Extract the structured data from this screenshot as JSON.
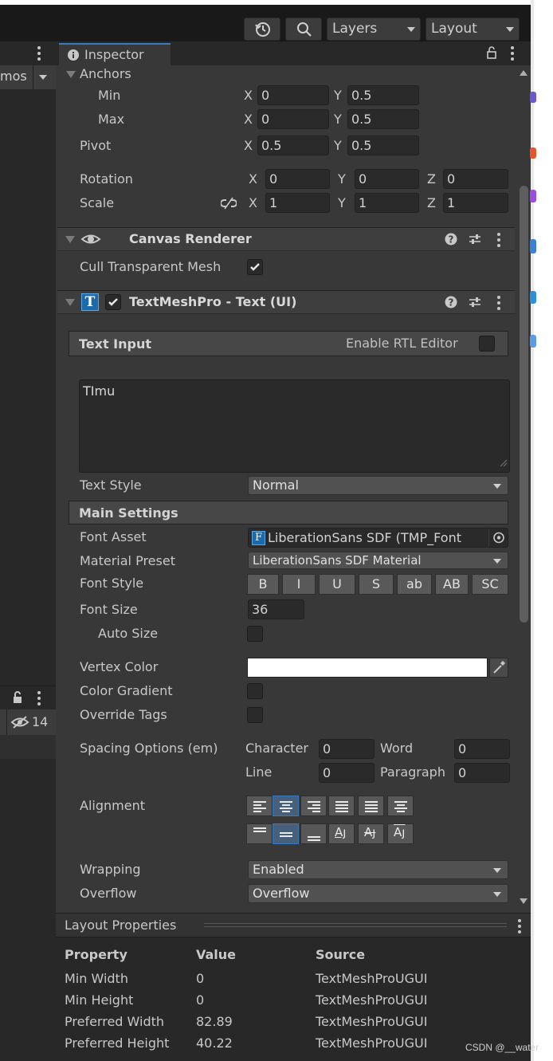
{
  "toolbar": {
    "history_icon": "history-icon",
    "search_icon": "search-icon",
    "layers_label": "Layers",
    "layout_label": "Layout"
  },
  "left_panel": {
    "tab_label": "mos",
    "hidden_count": "14"
  },
  "inspector": {
    "tab_title": "Inspector",
    "anchors": {
      "label": "Anchors",
      "min_label": "Min",
      "max_label": "Max",
      "min_x": "0",
      "min_y": "0.5",
      "max_x": "0",
      "max_y": "0.5"
    },
    "pivot": {
      "label": "Pivot",
      "x": "0.5",
      "y": "0.5"
    },
    "rotation": {
      "label": "Rotation",
      "x": "0",
      "y": "0",
      "z": "0"
    },
    "scale": {
      "label": "Scale",
      "x": "1",
      "y": "1",
      "z": "1"
    },
    "axis": {
      "x": "X",
      "y": "Y",
      "z": "Z"
    },
    "canvas_renderer": {
      "title": "Canvas Renderer",
      "cull_label": "Cull Transparent Mesh",
      "cull_checked": true
    },
    "tmp": {
      "title": "TextMeshPro - Text (UI)",
      "text_input_label": "Text Input",
      "rtl_label": "Enable RTL Editor",
      "text_value": "TImu",
      "text_style_label": "Text Style",
      "text_style_value": "Normal",
      "main_settings_label": "Main Settings",
      "font_asset_label": "Font Asset",
      "font_asset_value": "LiberationSans SDF (TMP_Font",
      "material_preset_label": "Material Preset",
      "material_preset_value": "LiberationSans SDF Material",
      "font_style_label": "Font Style",
      "font_style_buttons": [
        "B",
        "I",
        "U",
        "S",
        "ab",
        "AB",
        "SC"
      ],
      "font_size_label": "Font Size",
      "font_size_value": "36",
      "auto_size_label": "Auto Size",
      "vertex_color_label": "Vertex Color",
      "vertex_color": "#ffffff",
      "color_gradient_label": "Color Gradient",
      "override_tags_label": "Override Tags",
      "spacing_label": "Spacing Options (em)",
      "character_label": "Character",
      "character_value": "0",
      "word_label": "Word",
      "word_value": "0",
      "line_label": "Line",
      "line_value": "0",
      "paragraph_label": "Paragraph",
      "paragraph_value": "0",
      "alignment_label": "Alignment",
      "wrapping_label": "Wrapping",
      "wrapping_value": "Enabled",
      "overflow_label": "Overflow",
      "overflow_value": "Overflow"
    }
  },
  "layout_properties": {
    "title": "Layout Properties",
    "columns": [
      "Property",
      "Value",
      "Source"
    ],
    "rows": [
      [
        "Min Width",
        "0",
        "TextMeshProUGUI"
      ],
      [
        "Min Height",
        "0",
        "TextMeshProUGUI"
      ],
      [
        "Preferred Width",
        "82.89",
        "TextMeshProUGUI"
      ],
      [
        "Preferred Height",
        "40.22",
        "TextMeshProUGUI"
      ]
    ]
  },
  "watermark": "CSDN @__water",
  "colors": {
    "accent": "#3a79bb",
    "panel": "#383838",
    "header": "#3e3e3e"
  }
}
